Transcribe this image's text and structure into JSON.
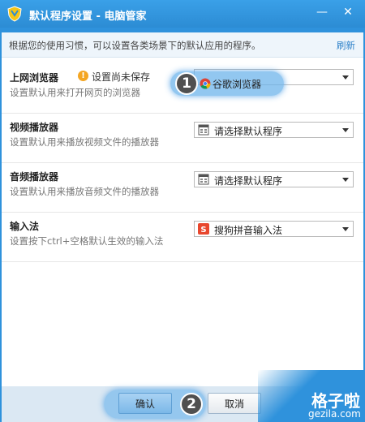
{
  "window": {
    "title": "默认程序设置 - 电脑管家"
  },
  "info": {
    "text": "根据您的使用习惯，可以设置各类场景下的默认应用的程序。",
    "refresh": "刷新"
  },
  "rows": [
    {
      "title": "上网浏览器",
      "desc": "设置默认用来打开网页的浏览器",
      "warning": "设置尚未保存",
      "selected": "谷歌浏览器",
      "icon": "chrome-icon"
    },
    {
      "title": "视频播放器",
      "desc": "设置默认用来播放视频文件的播放器",
      "selected": "请选择默认程序",
      "icon": "window-icon"
    },
    {
      "title": "音频播放器",
      "desc": "设置默认用来播放音频文件的播放器",
      "selected": "请选择默认程序",
      "icon": "window-icon"
    },
    {
      "title": "输入法",
      "desc": "设置按下ctrl+空格默认生效的输入法",
      "selected": "搜狗拼音输入法",
      "icon": "sogou-icon"
    }
  ],
  "steps": [
    "1",
    "2"
  ],
  "buttons": {
    "ok": "确认",
    "cancel": "取消"
  },
  "watermark": {
    "cn": "格子啦",
    "en": "gezila.com"
  },
  "colors": {
    "title_bar": "#2f92dc",
    "accent": "#2a7fc8",
    "warning": "#f4a623"
  }
}
